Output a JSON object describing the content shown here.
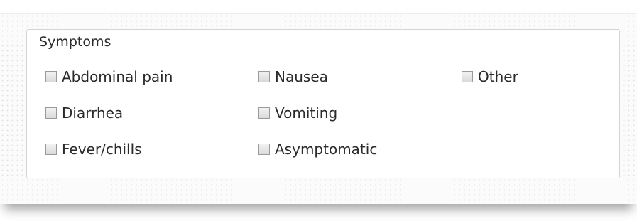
{
  "group": {
    "legend": "Symptoms",
    "options": [
      {
        "label": "Abdominal pain",
        "checked": false
      },
      {
        "label": "Nausea",
        "checked": false
      },
      {
        "label": "Other",
        "checked": false
      },
      {
        "label": "Diarrhea",
        "checked": false
      },
      {
        "label": "Vomiting",
        "checked": false
      },
      {
        "label": "Fever/chills",
        "checked": false
      },
      {
        "label": "Asymptomatic",
        "checked": false
      }
    ]
  }
}
